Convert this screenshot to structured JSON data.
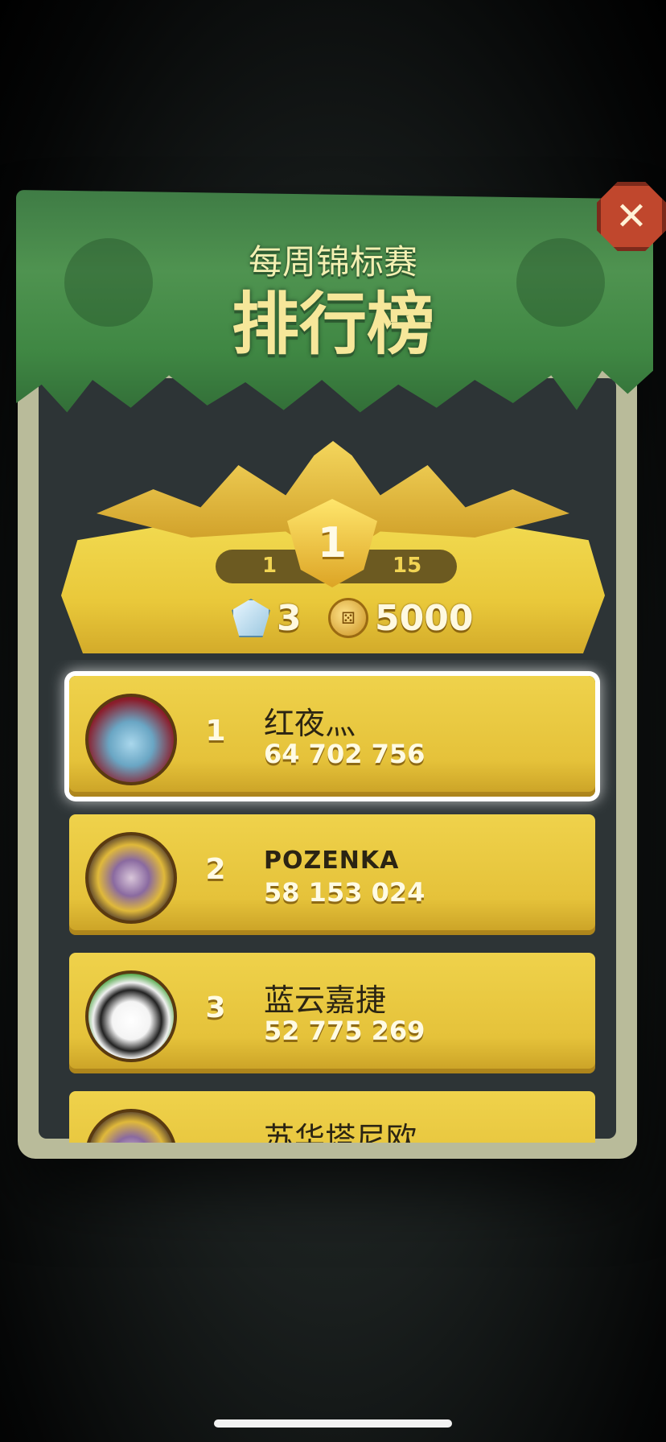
{
  "header": {
    "subtitle": "每周锦标赛",
    "title": "排行榜",
    "close_icon": "close-x-icon"
  },
  "rewards": {
    "rank_badge": "1",
    "range_low": "1",
    "range_high": "15",
    "gem_icon": "gem-icon",
    "gems": "3",
    "coin_icon": "coin-icon",
    "coins": "5000"
  },
  "leaderboard": [
    {
      "rank": "1",
      "name": "红夜灬",
      "score": "64 702 756",
      "avatar": "dragon-avatar-icon",
      "selected": true
    },
    {
      "rank": "2",
      "name": "POZENKA",
      "score": "58 153 024",
      "avatar": "sorceress-avatar-icon",
      "selected": false
    },
    {
      "rank": "3",
      "name": "蓝云嘉捷",
      "score": "52 775 269",
      "avatar": "panda-avatar-icon",
      "selected": false
    },
    {
      "rank": "",
      "name": "苏华塔尼欧",
      "score": "",
      "avatar": "sorceress-avatar-icon",
      "selected": false
    }
  ],
  "colors": {
    "banner_green": "#4f9350",
    "plate_gold": "#e9c83a",
    "close_red": "#c0472d"
  }
}
